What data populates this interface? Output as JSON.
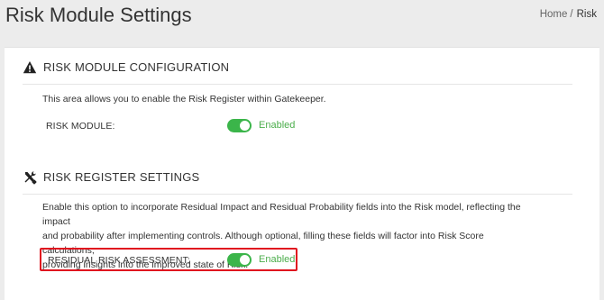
{
  "header": {
    "title": "Risk Module Settings",
    "breadcrumb": {
      "home": "Home",
      "separator": "/",
      "current": "Risk"
    }
  },
  "risk_module_configuration": {
    "icon": "warning-icon",
    "title": "RISK MODULE CONFIGURATION",
    "description": "This area allows you to enable the Risk Register within Gatekeeper.",
    "field_label": "RISK MODULE:",
    "toggle_on": true,
    "status": "Enabled"
  },
  "risk_register_settings": {
    "icon": "tools-icon",
    "title": "RISK REGISTER SETTINGS",
    "description_lines": [
      "Enable this option to incorporate Residual Impact and Residual Probability fields into the Risk model, reflecting the impact",
      "and probability after implementing controls. Although optional, filling these fields will factor into Risk Score calculations,",
      "providing insights into the improved state of Risk."
    ],
    "field_label": "RESIDUAL RISK ASSESSMENT:",
    "toggle_on": true,
    "status": "Enabled"
  },
  "colors": {
    "toggle_on": "#3bb54a",
    "status_text": "#4cae4c",
    "highlight_border": "#e0141f"
  }
}
